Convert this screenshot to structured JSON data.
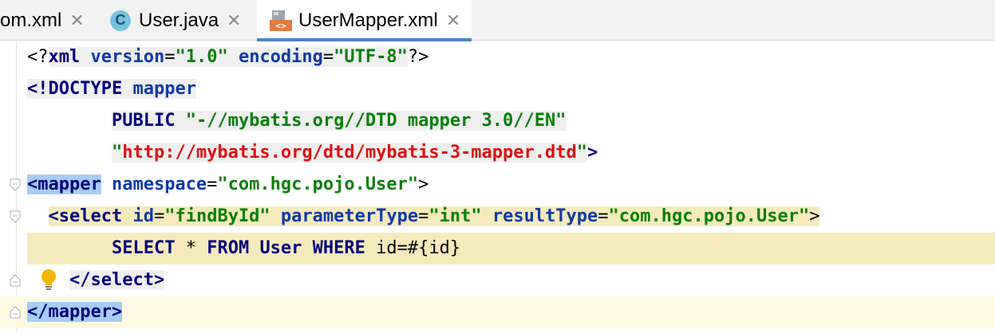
{
  "tabs": [
    {
      "label": "om.xml",
      "close": "✕",
      "icon": "none"
    },
    {
      "label": "User.java",
      "close": "✕",
      "icon": "java-class-icon",
      "icon_glyph": "C"
    },
    {
      "label": "UserMapper.xml",
      "close": "✕",
      "icon": "xml-file-icon",
      "icon_glyph": "<>",
      "active": true
    }
  ],
  "code": {
    "line1": {
      "open": "<?",
      "decl": "xml",
      "a1": " version",
      "eq1": "=",
      "v1": "\"1.0\"",
      "a2": " encoding",
      "eq2": "=",
      "v2": "\"UTF-8\"",
      "close": "?>"
    },
    "line2": {
      "doctype": "<!DOCTYPE",
      "name": " mapper"
    },
    "line3": {
      "indent": "        ",
      "public": "PUBLIC",
      "space": " ",
      "dtd": "\"-//mybatis.org//DTD mapper 3.0//EN\""
    },
    "line4": {
      "indent": "        ",
      "q1": "\"",
      "url": "http://mybatis.org/dtd/mybatis-3-mapper.dtd",
      "q2": "\"",
      "close": ">"
    },
    "line5": {
      "tag": "<mapper",
      "attr": " namespace",
      "eq": "=",
      "val": "\"com.hgc.pojo.User\"",
      "close": ">"
    },
    "line6": {
      "indent": "  ",
      "tag": "<select",
      "a1": " id",
      "eq1": "=",
      "v1": "\"findById\"",
      "a2": " parameterType",
      "eq2": "=",
      "v2": "\"int\"",
      "a3": " resultType",
      "eq3": "=",
      "v3": "\"com.hgc.pojo.User\"",
      "close": ">"
    },
    "line7": {
      "indent": "        ",
      "k1": "SELECT",
      "t1": " * ",
      "k2": "FROM",
      "t2": " ",
      "k3": "User",
      "t3": " ",
      "k4": "WHERE",
      "t4": " id=#{id}"
    },
    "line8": {
      "indent": "    ",
      "tag": "</select>"
    },
    "line9": {
      "tag": "</mapper>"
    }
  },
  "colors": {
    "tag": "#00007f",
    "attribute": "#0b3aa8",
    "string": "#068008",
    "url": "#e01010",
    "current_line": "#fffae3",
    "tag_highlight": "#a6cdf6",
    "sql_injection_bg": "#f5eabc"
  }
}
